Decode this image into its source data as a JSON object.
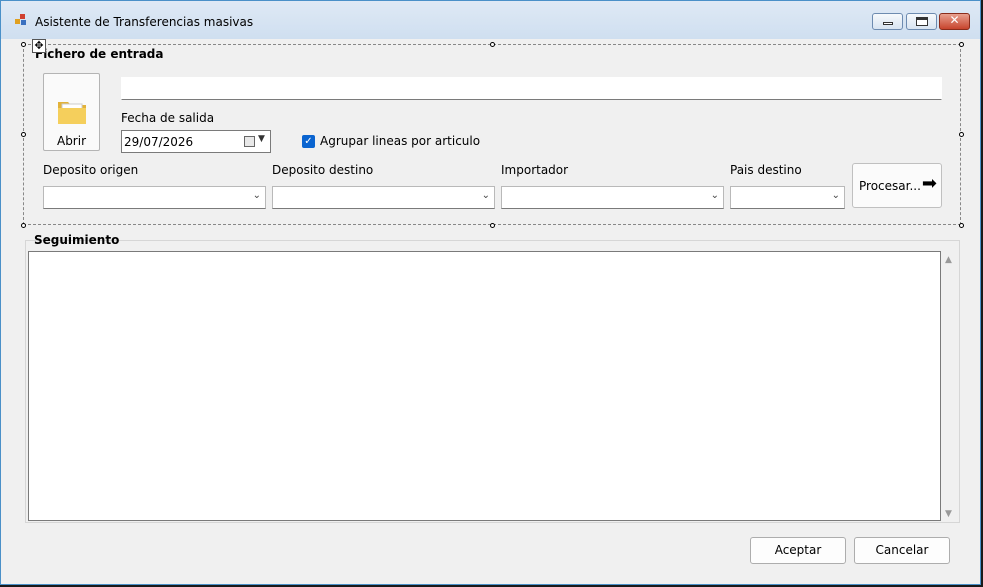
{
  "window": {
    "title": "Asistente de Transferencias masivas",
    "close_glyph": "✕"
  },
  "group_input": {
    "title": "Fichero de entrada",
    "move_glyph": "✥"
  },
  "open_button": {
    "label": "Abrir",
    "icon": "folder-icon"
  },
  "file_path": {
    "value": ""
  },
  "departure_date": {
    "label": "Fecha de salida",
    "value": "29/07/2026"
  },
  "group_lines": {
    "label": "Agrupar lineas por articulo",
    "checked": true,
    "check_glyph": "✓"
  },
  "filters": [
    {
      "label": "Deposito origen",
      "value": ""
    },
    {
      "label": "Deposito destino",
      "value": ""
    },
    {
      "label": "Importador",
      "value": ""
    },
    {
      "label": "Pais destino",
      "value": ""
    }
  ],
  "chevron_glyph": "⌄",
  "process_button": {
    "label": "Procesar...",
    "arrow_glyph": "➡"
  },
  "tracking": {
    "title": "Seguimiento",
    "content": "",
    "up_glyph": "▲",
    "down_glyph": "▼"
  },
  "dialog": {
    "accept_label": "Aceptar",
    "cancel_label": "Cancelar"
  },
  "colors": {
    "accent": "#0a64d0",
    "window_border": "#4a90c8"
  }
}
